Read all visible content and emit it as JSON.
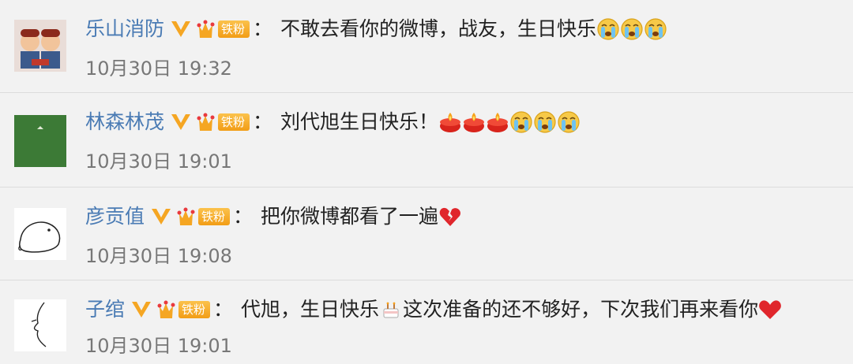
{
  "comments": [
    {
      "username": "乐山消防",
      "badge": "5",
      "fan_label": "铁粉",
      "text": "不敢去看你的微博，战友，生日快乐",
      "emoji_after": [
        "crying-face-icon",
        "crying-face-icon",
        "crying-face-icon"
      ],
      "time": "10月30日 19:32",
      "colon": "："
    },
    {
      "username": "林森林茂",
      "badge": "2",
      "fan_label": "铁粉",
      "text": "刘代旭生日快乐！",
      "emoji_after": [
        "candle-icon",
        "candle-icon",
        "candle-icon",
        "crying-face-icon",
        "crying-face-icon",
        "crying-face-icon"
      ],
      "time": "10月30日 19:01",
      "colon": "："
    },
    {
      "username": "彦贡值",
      "badge": "5",
      "fan_label": "铁粉",
      "text": "把你微博都看了一遍",
      "emoji_after": [
        "broken-heart-icon"
      ],
      "time": "10月30日 19:08",
      "colon": "："
    },
    {
      "username": "子绾",
      "badge": "2",
      "fan_label": "铁粉",
      "text_part1": "代旭，生日快乐",
      "text_part2": " 这次准备的还不够好，下次我们再来看你",
      "emoji_mid": "cake-icon",
      "emoji_after": [
        "heart-icon"
      ],
      "time": "10月30日 19:01",
      "colon": "："
    }
  ],
  "colors": {
    "username": "#4a7bb4",
    "vbadge": "#f5a623",
    "fan_badge": "#f29d16",
    "background": "#f2f2f2"
  }
}
